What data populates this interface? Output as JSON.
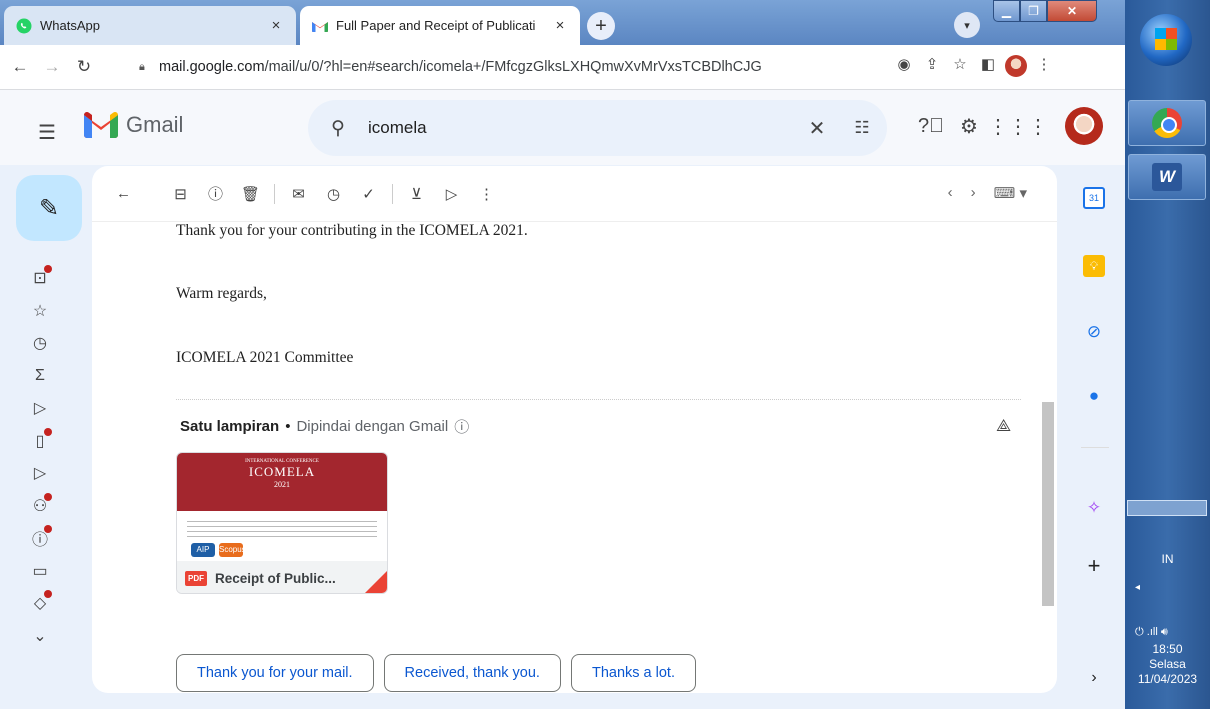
{
  "browser": {
    "tabs": [
      {
        "title": "WhatsApp",
        "close": "×"
      },
      {
        "title": "Full Paper and Receipt of Publicati",
        "close": "×"
      }
    ],
    "new_tab": "+",
    "url_host": "mail.google.com",
    "url_path": "/mail/u/0/?hl=en#search/icomela+/FMfcgzGlksLXHQmwXvMrVxsTCBDlhCJG"
  },
  "gmail": {
    "logo_text": "Gmail",
    "search_value": "icomela"
  },
  "message": {
    "lines": [
      "Thank you for your contributing in the ICOMELA 2021.",
      "Warm regards,",
      "ICOMELA 2021 Committee"
    ],
    "attachment_heading": "Satu lampiran",
    "attachment_separator": "•",
    "attachment_scan": "Dipindai dengan Gmail",
    "attachment_name": "Receipt of Public...",
    "attachment_badge": "PDF",
    "thumbnail": {
      "conference": "INTERNATIONAL CONFERENCE",
      "name": "ICOMELA",
      "year": "2021",
      "logos": [
        "AIP",
        "Scopus"
      ]
    }
  },
  "smart_replies": [
    "Thank you for your mail.",
    "Received, thank you.",
    "Thanks a lot."
  ],
  "taskbar": {
    "language": "IN",
    "time": "18:50",
    "day": "Selasa",
    "date": "11/04/2023"
  },
  "colors": {
    "compose_bg": "#c2e7ff",
    "search_bg": "#eaf1fb",
    "reply_text": "#0b57d0",
    "badge_red": "#c5221f"
  }
}
